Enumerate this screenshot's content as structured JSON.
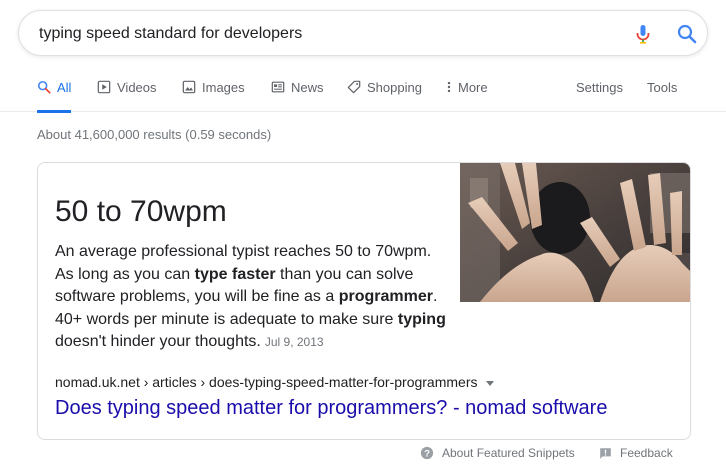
{
  "search": {
    "query": "typing speed standard for developers"
  },
  "tabs": [
    {
      "label": "All",
      "icon": "search-icon"
    },
    {
      "label": "Videos",
      "icon": "video-icon"
    },
    {
      "label": "Images",
      "icon": "image-icon"
    },
    {
      "label": "News",
      "icon": "news-icon"
    },
    {
      "label": "Shopping",
      "icon": "tag-icon"
    },
    {
      "label": "More",
      "icon": "more-vert-icon"
    }
  ],
  "tools": {
    "settings_label": "Settings",
    "tools_label": "Tools"
  },
  "result_stats": "About 41,600,000 results (0.59 seconds)",
  "featured_snippet": {
    "answer": "50 to 70wpm",
    "text_1": "An average professional typist reaches 50 to 70wpm. As long as you can ",
    "bold_1": "type faster",
    "text_2": " than you can solve software problems, you will be fine as a ",
    "bold_2": "programmer",
    "text_3": ". 40+ words per minute is adequate to make sure ",
    "bold_3": "typing",
    "text_4": " doesn't hinder your thoughts.",
    "date": "Jul 9, 2013",
    "cite": "nomad.uk.net › articles › does-typing-speed-matter-for-programmers",
    "title": "Does typing speed matter for programmers? - nomad software"
  },
  "footer": {
    "about_label": "About Featured Snippets",
    "feedback_label": "Feedback"
  },
  "colors": {
    "accent": "#1a73e8",
    "link": "#1a0dab"
  }
}
